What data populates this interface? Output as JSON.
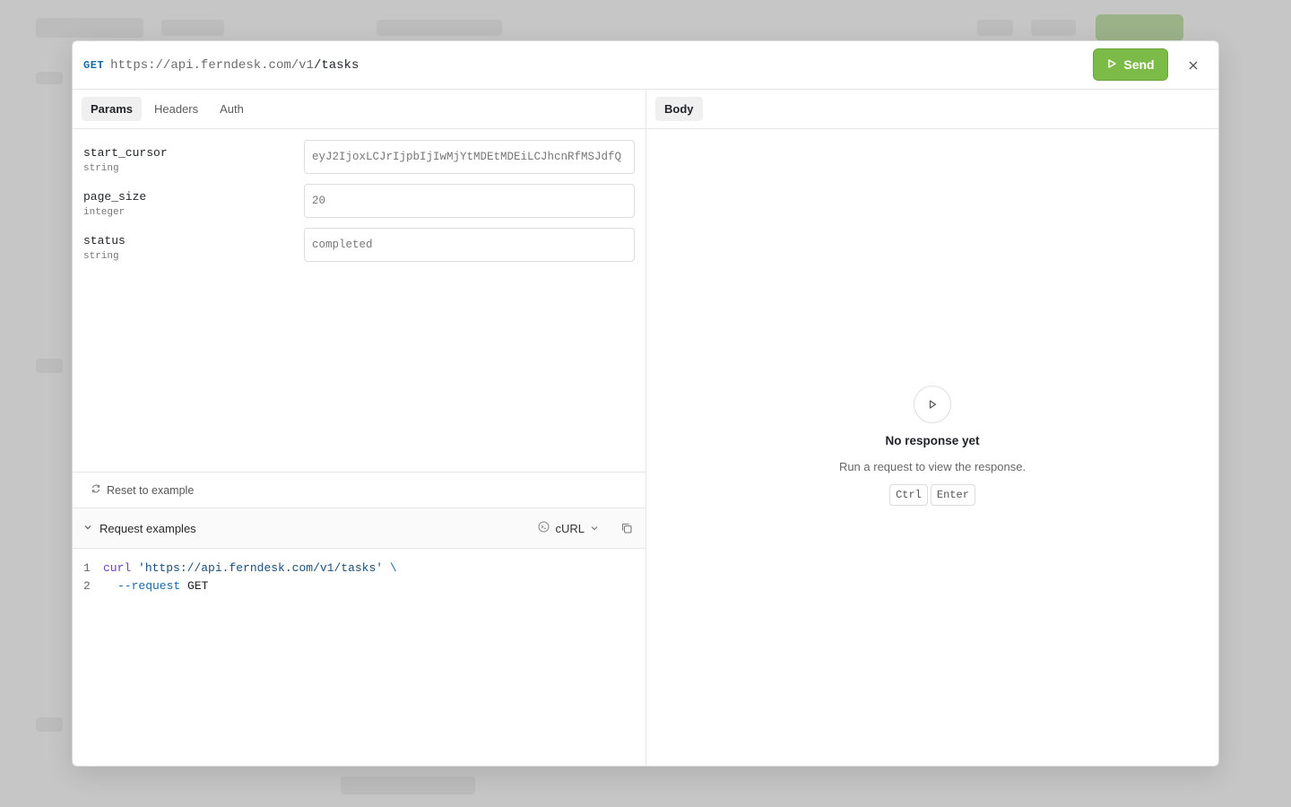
{
  "request": {
    "method": "GET",
    "url_base": "https://api.ferndesk.com/v1",
    "url_path": "/tasks",
    "send_label": "Send"
  },
  "left_tabs": [
    "Params",
    "Headers",
    "Auth"
  ],
  "params": [
    {
      "name": "start_cursor",
      "type": "string",
      "value": "eyJ2IjoxLCJrIjpbIjIwMjYtMDEtMDEiLCJhcnRfMSJdfQ"
    },
    {
      "name": "page_size",
      "type": "integer",
      "value": "20"
    },
    {
      "name": "status",
      "type": "string",
      "value": "completed"
    }
  ],
  "reset_label": "Reset to example",
  "examples": {
    "title": "Request examples",
    "language": "cURL",
    "code": {
      "line1_num": "1",
      "line1_cmd": "curl",
      "line1_url": "'https://api.ferndesk.com/v1/tasks'",
      "line1_cont": "\\",
      "line2_num": "2",
      "line2_flag": "--request",
      "line2_val": "GET"
    }
  },
  "right_tabs": [
    "Body"
  ],
  "response": {
    "empty_title": "No response yet",
    "empty_sub": "Run a request to view the response.",
    "keys": [
      "Ctrl",
      "Enter"
    ]
  }
}
